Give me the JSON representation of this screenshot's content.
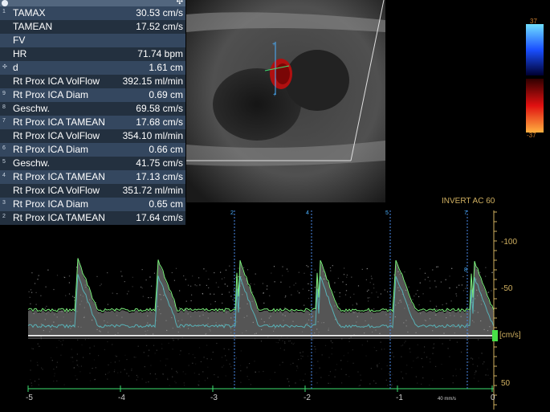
{
  "measurements": [
    {
      "num": "1",
      "label": "TAMAX",
      "value": "30.53 cm/s"
    },
    {
      "num": "",
      "label": "TAMEAN",
      "value": "17.52 cm/s"
    },
    {
      "num": "",
      "label": "FV",
      "value": ""
    },
    {
      "num": "",
      "label": "HR",
      "value": "71.74 bpm"
    },
    {
      "num": "✣",
      "label": "d",
      "value": "1.61 cm"
    },
    {
      "num": "",
      "label": "Rt Prox ICA VolFlow",
      "value": "392.15 ml/min"
    },
    {
      "num": "9",
      "label": "Rt Prox ICA Diam",
      "value": "0.69 cm"
    },
    {
      "num": "8",
      "label": "Geschw.",
      "value": "69.58 cm/s"
    },
    {
      "num": "7",
      "label": "Rt Prox ICA TAMEAN",
      "value": "17.68 cm/s"
    },
    {
      "num": "",
      "label": "Rt Prox ICA VolFlow",
      "value": "354.10 ml/min"
    },
    {
      "num": "6",
      "label": "Rt Prox ICA Diam",
      "value": "0.66 cm"
    },
    {
      "num": "5",
      "label": "Geschw.",
      "value": "41.75 cm/s"
    },
    {
      "num": "4",
      "label": "Rt Prox ICA TAMEAN",
      "value": "17.13 cm/s"
    },
    {
      "num": "",
      "label": "Rt Prox ICA VolFlow",
      "value": "351.72 ml/min"
    },
    {
      "num": "3",
      "label": "Rt Prox ICA Diam",
      "value": "0.65 cm"
    },
    {
      "num": "2",
      "label": "Rt Prox ICA TAMEAN",
      "value": "17.64 cm/s"
    }
  ],
  "colorbar": {
    "top": "37",
    "bottom": "-37"
  },
  "doppler": {
    "mode_label": "INVERT  AC 60",
    "units": "[cm/s]",
    "y_ticks": [
      {
        "text": "-100"
      },
      {
        "text": "-50"
      },
      {
        "text": "50"
      }
    ],
    "x_ticks": [
      "-5",
      "-4",
      "-3",
      "-2",
      "-1",
      "0"
    ],
    "sweep_speed": "40 mm/s",
    "markers": [
      "2",
      "4",
      "5",
      "7",
      "8"
    ]
  },
  "colors": {
    "panel_odd": "#34475f",
    "panel_even": "#23303f",
    "accent_text": "#d0b060",
    "envelope": "#7cf07c",
    "marker": "#4a8ae8"
  }
}
